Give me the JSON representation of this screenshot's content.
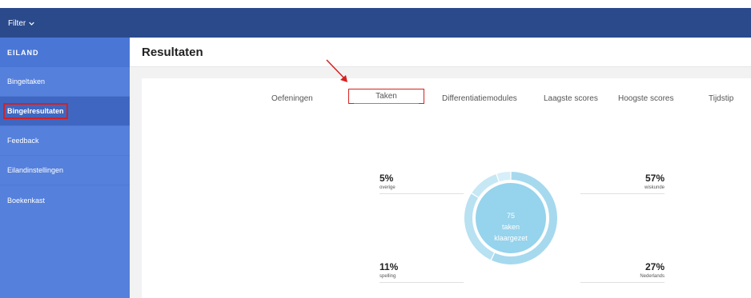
{
  "topbar": {
    "filter_label": "Filter"
  },
  "sidebar": {
    "heading": "EILAND",
    "items": [
      {
        "label": "Bingeltaken",
        "active": false
      },
      {
        "label": "Bingelresultaten",
        "active": true
      },
      {
        "label": "Feedback",
        "active": false
      },
      {
        "label": "Eilandinstellingen",
        "active": false
      },
      {
        "label": "Boekenkast",
        "active": false
      }
    ]
  },
  "main": {
    "title": "Resultaten",
    "tabs": [
      {
        "label": "Oefeningen"
      },
      {
        "label": "Taken"
      },
      {
        "label": "Differentiatiemodules"
      },
      {
        "label": "Laagste scores"
      },
      {
        "label": "Hoogste scores"
      },
      {
        "label": "Tijdstip"
      }
    ],
    "active_tab": "Taken",
    "stats": [
      {
        "percent": "5%",
        "label": "overige"
      },
      {
        "percent": "57%",
        "label": "wiskunde"
      },
      {
        "percent": "11%",
        "label": "spelling"
      },
      {
        "percent": "27%",
        "label": "Nederlands"
      }
    ],
    "donut": {
      "count": "75",
      "line2": "taken",
      "line3": "klaargezet",
      "slices": [
        {
          "name": "wiskunde",
          "fraction": 0.57,
          "color": "#a6d9ee"
        },
        {
          "name": "Nederlands",
          "fraction": 0.27,
          "color": "#b8e1f2"
        },
        {
          "name": "spelling",
          "fraction": 0.11,
          "color": "#c6e8f5"
        },
        {
          "name": "overige",
          "fraction": 0.05,
          "color": "#d6eff8"
        }
      ],
      "center_color": "#96d3ec"
    }
  },
  "colors": {
    "accent": "#2a4a8c",
    "sidebar": "#5580dc",
    "highlight": "#d62020"
  }
}
